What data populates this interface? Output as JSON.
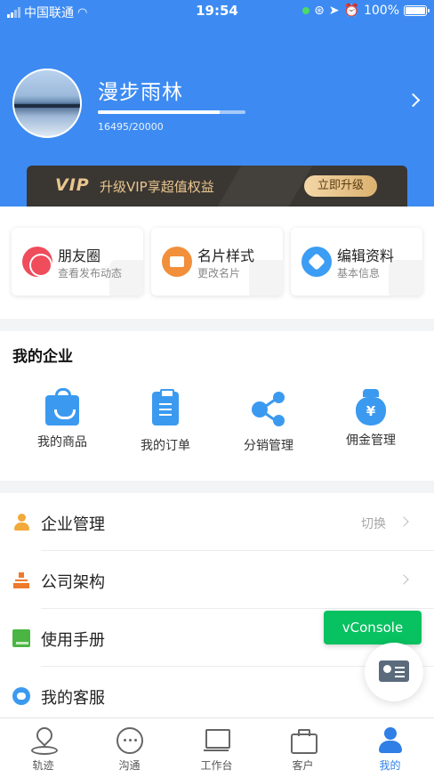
{
  "status_bar": {
    "carrier": "中国联通",
    "time": "19:54",
    "battery": "100%"
  },
  "profile": {
    "name": "漫步雨林",
    "exp_text": "16495/20000",
    "exp_fraction": 0.82475
  },
  "vip_banner": {
    "logo": "VIP",
    "text": "升级VIP享超值权益",
    "button": "立即升级",
    "color_text": "#e9c68e",
    "color_bg": "#3a3632"
  },
  "quick_cards": [
    {
      "title": "朋友圈",
      "subtitle": "查看发布动态",
      "icon": "camera-shutter-icon"
    },
    {
      "title": "名片样式",
      "subtitle": "更改名片",
      "icon": "business-card-icon"
    },
    {
      "title": "编辑资料",
      "subtitle": "基本信息",
      "icon": "edit-pen-icon"
    }
  ],
  "enterprise": {
    "title": "我的企业",
    "items": [
      {
        "label": "我的商品",
        "icon": "shopping-bag-icon"
      },
      {
        "label": "我的订单",
        "icon": "clipboard-icon"
      },
      {
        "label": "分销管理",
        "icon": "share-network-icon"
      },
      {
        "label": "佣金管理",
        "icon": "money-bag-icon"
      }
    ]
  },
  "menu": [
    {
      "label": "企业管理",
      "extra": "切换",
      "icon": "user-icon"
    },
    {
      "label": "公司架构",
      "extra": "",
      "icon": "org-chart-icon"
    },
    {
      "label": "使用手册",
      "extra": "",
      "icon": "book-icon"
    },
    {
      "label": "我的客服",
      "extra": "",
      "icon": "customer-service-icon"
    }
  ],
  "vconsole": {
    "label": "vConsole"
  },
  "tabbar": [
    {
      "label": "轨迹",
      "icon": "location-pin-icon"
    },
    {
      "label": "沟通",
      "icon": "chat-bubble-icon"
    },
    {
      "label": "工作台",
      "icon": "desk-icon"
    },
    {
      "label": "客户",
      "icon": "briefcase-icon"
    },
    {
      "label": "我的",
      "icon": "person-icon",
      "active": true
    }
  ],
  "colors": {
    "primary": "#3d8bf2",
    "vconsole_green": "#08c160",
    "tab_active": "#2f7fe6"
  }
}
